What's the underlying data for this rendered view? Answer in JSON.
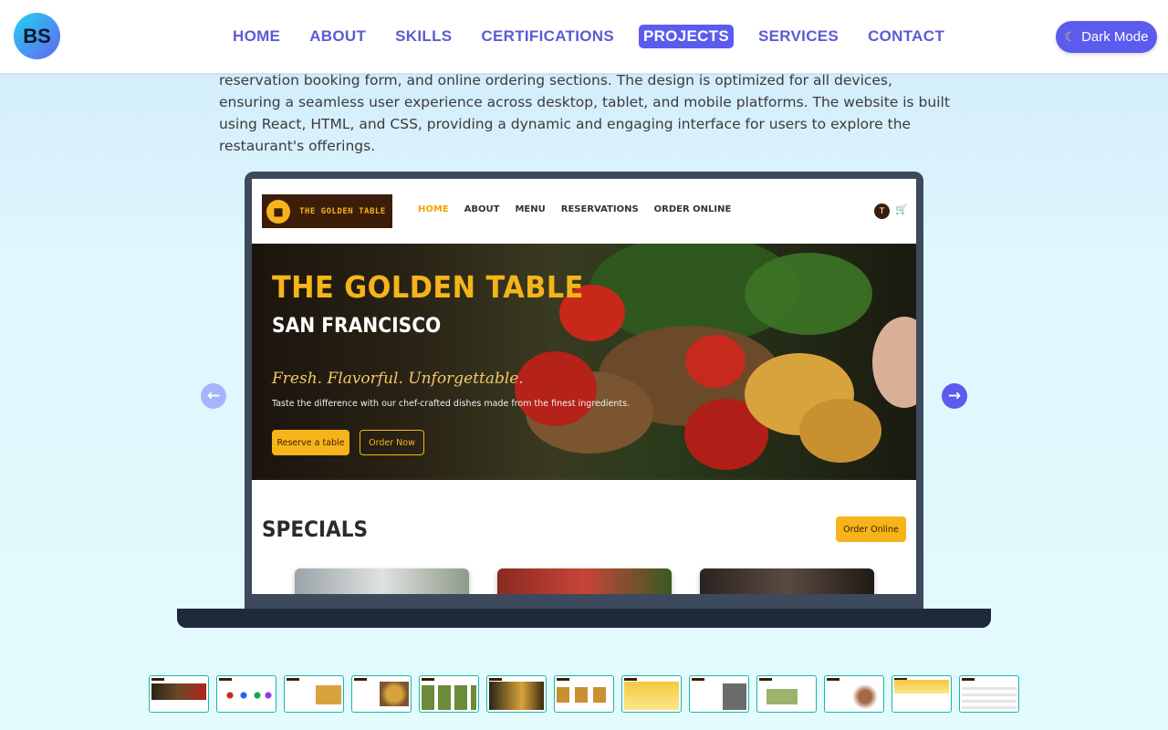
{
  "header": {
    "logo_text": "BS",
    "nav": [
      "HOME",
      "ABOUT",
      "SKILLS",
      "CERTIFICATIONS",
      "PROJECTS",
      "SERVICES",
      "CONTACT"
    ],
    "active_nav": "PROJECTS",
    "dark_mode_label": "Dark Mode",
    "dark_mode_icon": "moon-icon"
  },
  "description": "reservation booking form, and online ordering sections. The design is optimized for all devices, ensuring a seamless user experience across desktop, tablet, and mobile platforms. The website is built using React, HTML, and CSS, providing a dynamic and engaging interface for users to explore the restaurant's offerings.",
  "preview": {
    "logo_text": "THE GOLDEN TABLE",
    "nav": [
      "HOME",
      "ABOUT",
      "MENU",
      "RESERVATIONS",
      "ORDER ONLINE"
    ],
    "user_initial": "T",
    "cart_icon": "cart-icon",
    "hero_title": "THE GOLDEN TABLE",
    "hero_subtitle": "SAN FRANCISCO",
    "hero_tagline": "Fresh. Flavorful. Unforgettable.",
    "hero_text": "Taste the difference with our chef-crafted dishes made from the finest ingredients.",
    "reserve_button": "Reserve a table",
    "order_button": "Order Now",
    "specials_title": "SPECIALS",
    "specials_button": "Order Online"
  },
  "carousel": {
    "prev_icon": "arrow-left-icon",
    "next_icon": "arrow-right-icon",
    "thumbnail_count": 13,
    "active_thumbnail": 1
  },
  "colors": {
    "accent": "#5b5bf0",
    "gold": "#f5b41a",
    "brown": "#3b1d0a"
  }
}
